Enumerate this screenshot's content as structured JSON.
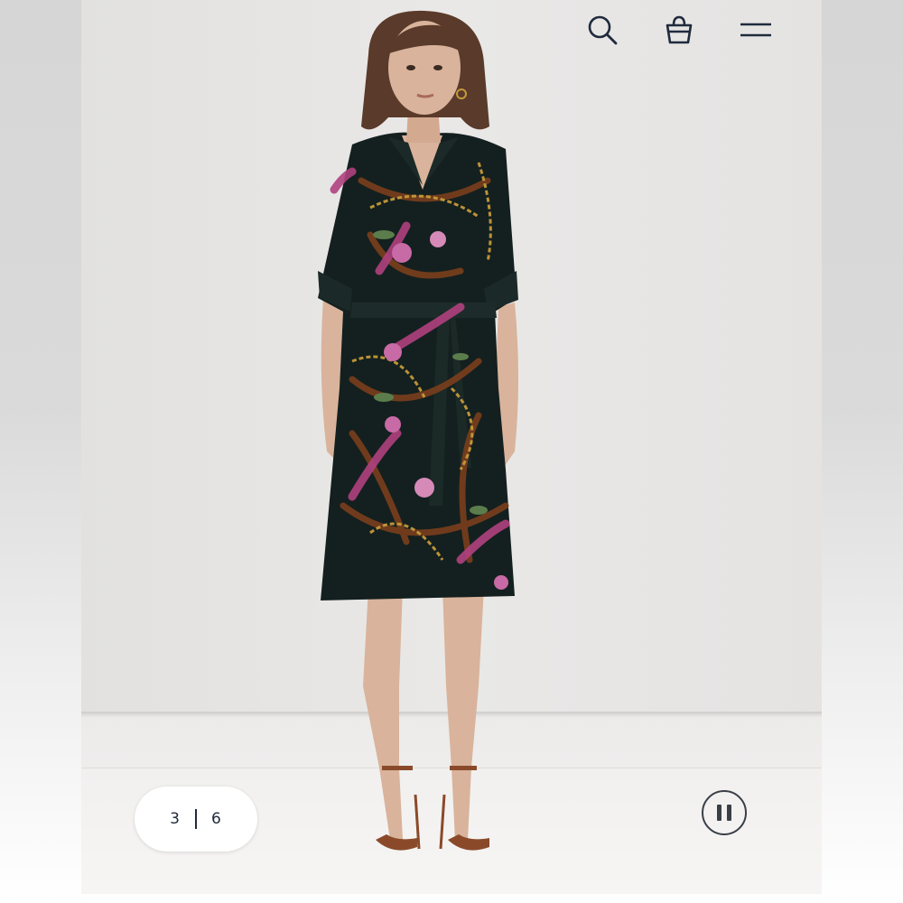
{
  "header": {
    "icons": {
      "search": "search-icon",
      "bag": "shopping-bag-icon",
      "menu": "hamburger-menu-icon"
    }
  },
  "gallery": {
    "current_index": "3",
    "total_count": "6",
    "playback_icon": "pause-icon"
  },
  "colors": {
    "icon": "#1f2a3c",
    "dress_base": "#14201f",
    "print_magenta": "#b0417f",
    "print_brown": "#7a3f1c",
    "print_gold": "#c49a3a",
    "skin": "#d9b39b",
    "hair": "#5a3a2a"
  }
}
